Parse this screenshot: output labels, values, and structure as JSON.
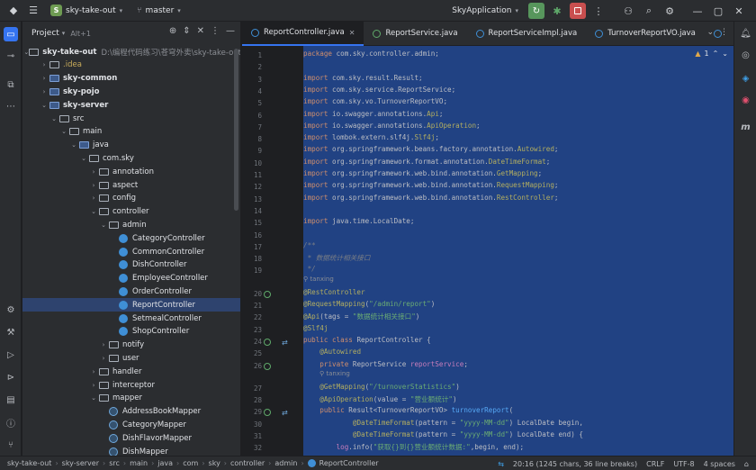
{
  "titlebar": {
    "project_badge": "S",
    "project_name": "sky-take-out",
    "branch": "master",
    "run_config": "SkyApplication"
  },
  "project_panel": {
    "title": "Project",
    "shortcut": "Alt+1",
    "tree": [
      {
        "label": "sky-take-out",
        "note": "D:\\编程代码练习\\苍穹外卖\\sky-take-out",
        "depth": 0,
        "arrow": "v",
        "kind": "folder",
        "bold": true
      },
      {
        "label": ".idea",
        "depth": 1,
        "arrow": ">",
        "kind": "folder",
        "dim": true
      },
      {
        "label": "sky-common",
        "depth": 1,
        "arrow": ">",
        "kind": "folder-blue",
        "bold": true
      },
      {
        "label": "sky-pojo",
        "depth": 1,
        "arrow": ">",
        "kind": "folder-blue",
        "bold": true
      },
      {
        "label": "sky-server",
        "depth": 1,
        "arrow": "v",
        "kind": "folder-blue",
        "bold": true
      },
      {
        "label": "src",
        "depth": 2,
        "arrow": "v",
        "kind": "folder"
      },
      {
        "label": "main",
        "depth": 3,
        "arrow": "v",
        "kind": "folder"
      },
      {
        "label": "java",
        "depth": 4,
        "arrow": "v",
        "kind": "folder-blue"
      },
      {
        "label": "com.sky",
        "depth": 5,
        "arrow": "v",
        "kind": "folder"
      },
      {
        "label": "annotation",
        "depth": 6,
        "arrow": ">",
        "kind": "folder"
      },
      {
        "label": "aspect",
        "depth": 6,
        "arrow": ">",
        "kind": "folder"
      },
      {
        "label": "config",
        "depth": 6,
        "arrow": ">",
        "kind": "folder"
      },
      {
        "label": "controller",
        "depth": 6,
        "arrow": "v",
        "kind": "folder"
      },
      {
        "label": "admin",
        "depth": 7,
        "arrow": "v",
        "kind": "folder"
      },
      {
        "label": "CategoryController",
        "depth": 8,
        "arrow": "",
        "kind": "class"
      },
      {
        "label": "CommonController",
        "depth": 8,
        "arrow": "",
        "kind": "class"
      },
      {
        "label": "DishController",
        "depth": 8,
        "arrow": "",
        "kind": "class"
      },
      {
        "label": "EmployeeController",
        "depth": 8,
        "arrow": "",
        "kind": "class"
      },
      {
        "label": "OrderController",
        "depth": 8,
        "arrow": "",
        "kind": "class"
      },
      {
        "label": "ReportController",
        "depth": 8,
        "arrow": "",
        "kind": "class",
        "selected": true
      },
      {
        "label": "SetmealController",
        "depth": 8,
        "arrow": "",
        "kind": "class"
      },
      {
        "label": "ShopController",
        "depth": 8,
        "arrow": "",
        "kind": "class"
      },
      {
        "label": "notify",
        "depth": 7,
        "arrow": ">",
        "kind": "folder"
      },
      {
        "label": "user",
        "depth": 7,
        "arrow": ">",
        "kind": "folder"
      },
      {
        "label": "handler",
        "depth": 6,
        "arrow": ">",
        "kind": "folder"
      },
      {
        "label": "interceptor",
        "depth": 6,
        "arrow": ">",
        "kind": "folder"
      },
      {
        "label": "mapper",
        "depth": 6,
        "arrow": "v",
        "kind": "folder"
      },
      {
        "label": "AddressBookMapper",
        "depth": 7,
        "arrow": "",
        "kind": "class-g"
      },
      {
        "label": "CategoryMapper",
        "depth": 7,
        "arrow": "",
        "kind": "class-g"
      },
      {
        "label": "DishFlavorMapper",
        "depth": 7,
        "arrow": "",
        "kind": "class-g"
      },
      {
        "label": "DishMapper",
        "depth": 7,
        "arrow": "",
        "kind": "class-g"
      }
    ]
  },
  "tabs": [
    {
      "label": "ReportController.java",
      "active": true,
      "icon": "class"
    },
    {
      "label": "ReportService.java",
      "active": false,
      "icon": "interface"
    },
    {
      "label": "ReportServiceImpl.java",
      "active": false,
      "icon": "class"
    },
    {
      "label": "TurnoverReportVO.java",
      "active": false,
      "icon": "class"
    }
  ],
  "inspections": "1",
  "code": [
    {
      "n": "1",
      "html": "<span class='kw'>package</span> com.sky.controller.admin;"
    },
    {
      "n": "2",
      "html": ""
    },
    {
      "n": "3",
      "html": "<span class='kw'>import</span> com.sky.result.Result;"
    },
    {
      "n": "4",
      "html": "<span class='kw'>import</span> com.sky.service.ReportService;"
    },
    {
      "n": "5",
      "html": "<span class='kw'>import</span> com.sky.vo.TurnoverReportVO;"
    },
    {
      "n": "6",
      "html": "<span class='kw'>import</span> io.swagger.annotations.<span class='ann'>Api</span>;"
    },
    {
      "n": "7",
      "html": "<span class='kw'>import</span> io.swagger.annotations.<span class='ann'>ApiOperation</span>;"
    },
    {
      "n": "8",
      "html": "<span class='kw'>import</span> lombok.extern.slf4j.<span class='ann'>Slf4j</span>;"
    },
    {
      "n": "9",
      "html": "<span class='kw'>import</span> org.springframework.beans.factory.annotation.<span class='ann'>Autowired</span>;"
    },
    {
      "n": "10",
      "html": "<span class='kw'>import</span> org.springframework.format.annotation.<span class='ann'>DateTimeFormat</span>;"
    },
    {
      "n": "11",
      "html": "<span class='kw'>import</span> org.springframework.web.bind.annotation.<span class='ann'>GetMapping</span>;"
    },
    {
      "n": "12",
      "html": "<span class='kw'>import</span> org.springframework.web.bind.annotation.<span class='ann'>RequestMapping</span>;"
    },
    {
      "n": "13",
      "html": "<span class='kw'>import</span> org.springframework.web.bind.annotation.<span class='ann'>RestController</span>;"
    },
    {
      "n": "14",
      "html": ""
    },
    {
      "n": "15",
      "html": "<span class='kw'>import</span> java.time.LocalDate;"
    },
    {
      "n": "16",
      "html": ""
    },
    {
      "n": "17",
      "html": "<span class='cm'>/**</span>"
    },
    {
      "n": "18",
      "html": "<span class='cm'> * 数据统计相关接口</span>"
    },
    {
      "n": "19",
      "html": "<span class='cm'> */</span>"
    },
    {
      "n": "",
      "hint": "tanxing"
    },
    {
      "n": "20",
      "html": "<span class='ann'>@RestController</span>"
    },
    {
      "n": "21",
      "html": "<span class='ann'>@RequestMapping</span>(<span class='str'>\"/admin/report\"</span>)"
    },
    {
      "n": "22",
      "html": "<span class='ann'>@Api</span>(tags = <span class='str'>\"数据统计相关接口\"</span>)"
    },
    {
      "n": "23",
      "html": "<span class='ann'>@Slf4j</span>"
    },
    {
      "n": "24",
      "html": "<span class='kw'>public class</span> ReportController {"
    },
    {
      "n": "25",
      "html": "    <span class='ann'>@Autowired</span>"
    },
    {
      "n": "26",
      "html": "    <span class='kw'>private</span> ReportService <span class='fld'>reportService</span>;"
    },
    {
      "n": "",
      "hint": "tanxing"
    },
    {
      "n": "27",
      "html": "    <span class='ann'>@GetMapping</span>(<span class='str'>\"/turnoverStatistics\"</span>)"
    },
    {
      "n": "28",
      "html": "    <span class='ann'>@ApiOperation</span>(value = <span class='str'>\"营业额统计\"</span>)"
    },
    {
      "n": "29",
      "html": "    <span class='kw'>public</span> Result&lt;TurnoverReportVO&gt; <span class='fn'>turnoverReport</span>("
    },
    {
      "n": "30",
      "html": "            <span class='ann'>@DateTimeFormat</span>(pattern = <span class='str'>\"yyyy-MM-dd\"</span>) LocalDate begin,"
    },
    {
      "n": "31",
      "html": "            <span class='ann'>@DateTimeFormat</span>(pattern = <span class='str'>\"yyyy-MM-dd\"</span>) LocalDate end) {"
    },
    {
      "n": "32",
      "html": "        <span class='fld'>log</span>.info(<span class='str'>\"获取{}到{}营业额统计数据:\"</span>,begin, end);"
    }
  ],
  "statusbar": {
    "crumbs": [
      "sky-take-out",
      "sky-server",
      "src",
      "main",
      "java",
      "com",
      "sky",
      "controller",
      "admin",
      "ReportController"
    ],
    "position": "20:16 (1245 chars, 36 line breaks)",
    "line_sep": "CRLF",
    "encoding": "UTF-8",
    "indent": "4 spaces"
  }
}
